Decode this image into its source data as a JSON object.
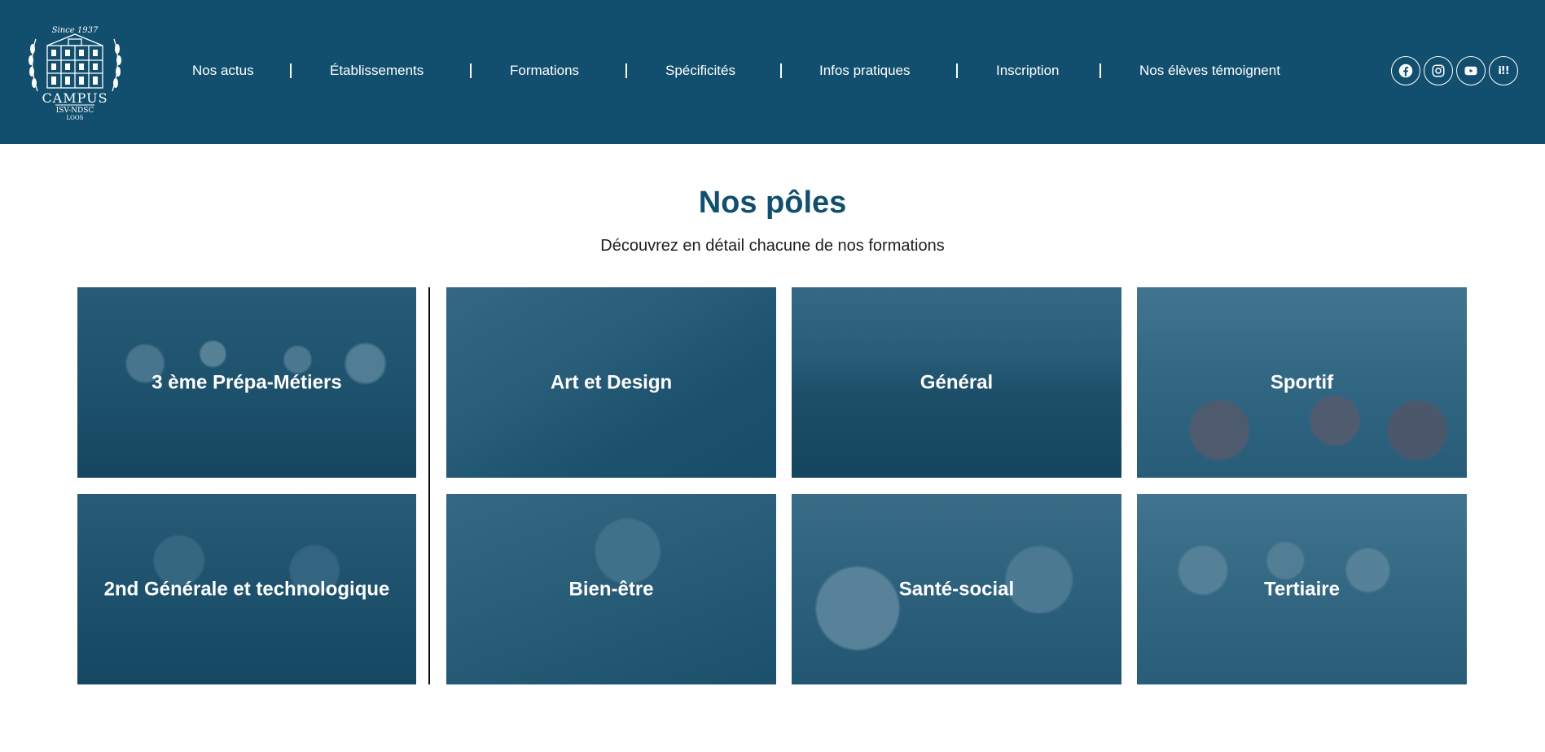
{
  "header": {
    "logo": {
      "since": "Since 1937",
      "name": "CAMPUS",
      "line2": "ISV-NDSC",
      "line3": "LOOS"
    },
    "nav": [
      {
        "label": "Nos actus"
      },
      {
        "label": "Établissements"
      },
      {
        "label": "Formations"
      },
      {
        "label": "Spécificités"
      },
      {
        "label": "Infos pratiques"
      },
      {
        "label": "Inscription"
      },
      {
        "label": "Nos élèves témoignent"
      }
    ],
    "socials": [
      {
        "icon": "facebook-icon"
      },
      {
        "icon": "instagram-icon"
      },
      {
        "icon": "youtube-icon"
      },
      {
        "icon": "onisep-icon",
        "text": "i!!"
      }
    ],
    "background": "#124f6f"
  },
  "main": {
    "title": "Nos pôles",
    "subtitle": "Découvrez en détail chacune de nos formations",
    "cards": [
      {
        "label": "3 ème Prépa-Métiers"
      },
      {
        "label": "Art et Design"
      },
      {
        "label": "Général"
      },
      {
        "label": "Sportif"
      },
      {
        "label": "2nd Générale et technologique"
      },
      {
        "label": "Bien-être"
      },
      {
        "label": "Santé-social"
      },
      {
        "label": "Tertiaire"
      }
    ]
  },
  "colors": {
    "brand": "#124f6f",
    "text": "#1f1f1f",
    "white": "#ffffff"
  }
}
